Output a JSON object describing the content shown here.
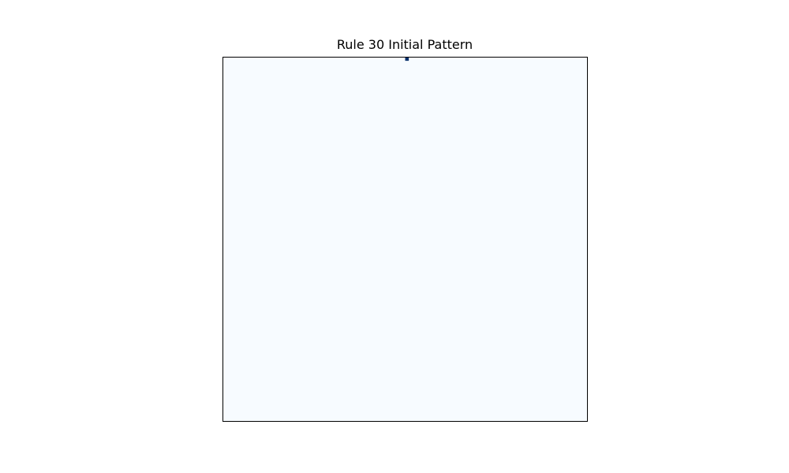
{
  "chart_data": {
    "type": "heatmap",
    "title": "Rule 30 Initial Pattern",
    "rule": 30,
    "grid": false,
    "colormap": {
      "zero": "#f7fbff",
      "one": "#08306b"
    },
    "frame_color": "#000000",
    "axes_visible": false,
    "n_rows": 100,
    "n_cols": 100,
    "active_cells": [
      {
        "row": 0,
        "col": 50,
        "value": 1
      }
    ]
  }
}
